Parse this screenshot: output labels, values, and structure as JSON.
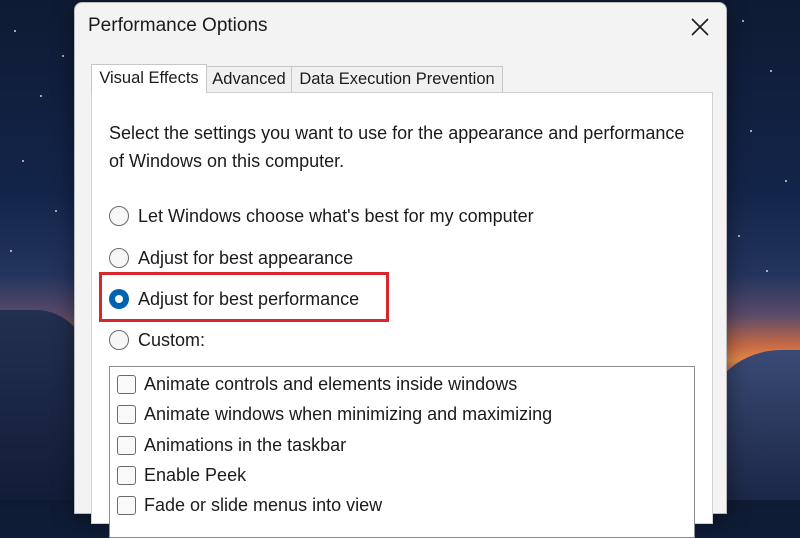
{
  "dialog": {
    "title": "Performance Options",
    "tabs": [
      {
        "label": "Visual Effects",
        "active": true
      },
      {
        "label": "Advanced",
        "active": false
      },
      {
        "label": "Data Execution Prevention",
        "active": false
      }
    ],
    "description": "Select the settings you want to use for the appearance and performance of Windows on this computer.",
    "options": [
      {
        "label": "Let Windows choose what's best for my computer",
        "selected": false
      },
      {
        "label": "Adjust for best appearance",
        "selected": false
      },
      {
        "label": "Adjust for best performance",
        "selected": true
      },
      {
        "label": "Custom:",
        "selected": false
      }
    ],
    "custom_items": [
      {
        "label": "Animate controls and elements inside windows",
        "checked": false
      },
      {
        "label": "Animate windows when minimizing and maximizing",
        "checked": false
      },
      {
        "label": "Animations in the taskbar",
        "checked": false
      },
      {
        "label": "Enable Peek",
        "checked": false
      },
      {
        "label": "Fade or slide menus into view",
        "checked": false
      }
    ]
  },
  "icons": {
    "close": "close-icon"
  },
  "colors": {
    "accent": "#0063b1",
    "highlight_box": "#d7262e"
  }
}
